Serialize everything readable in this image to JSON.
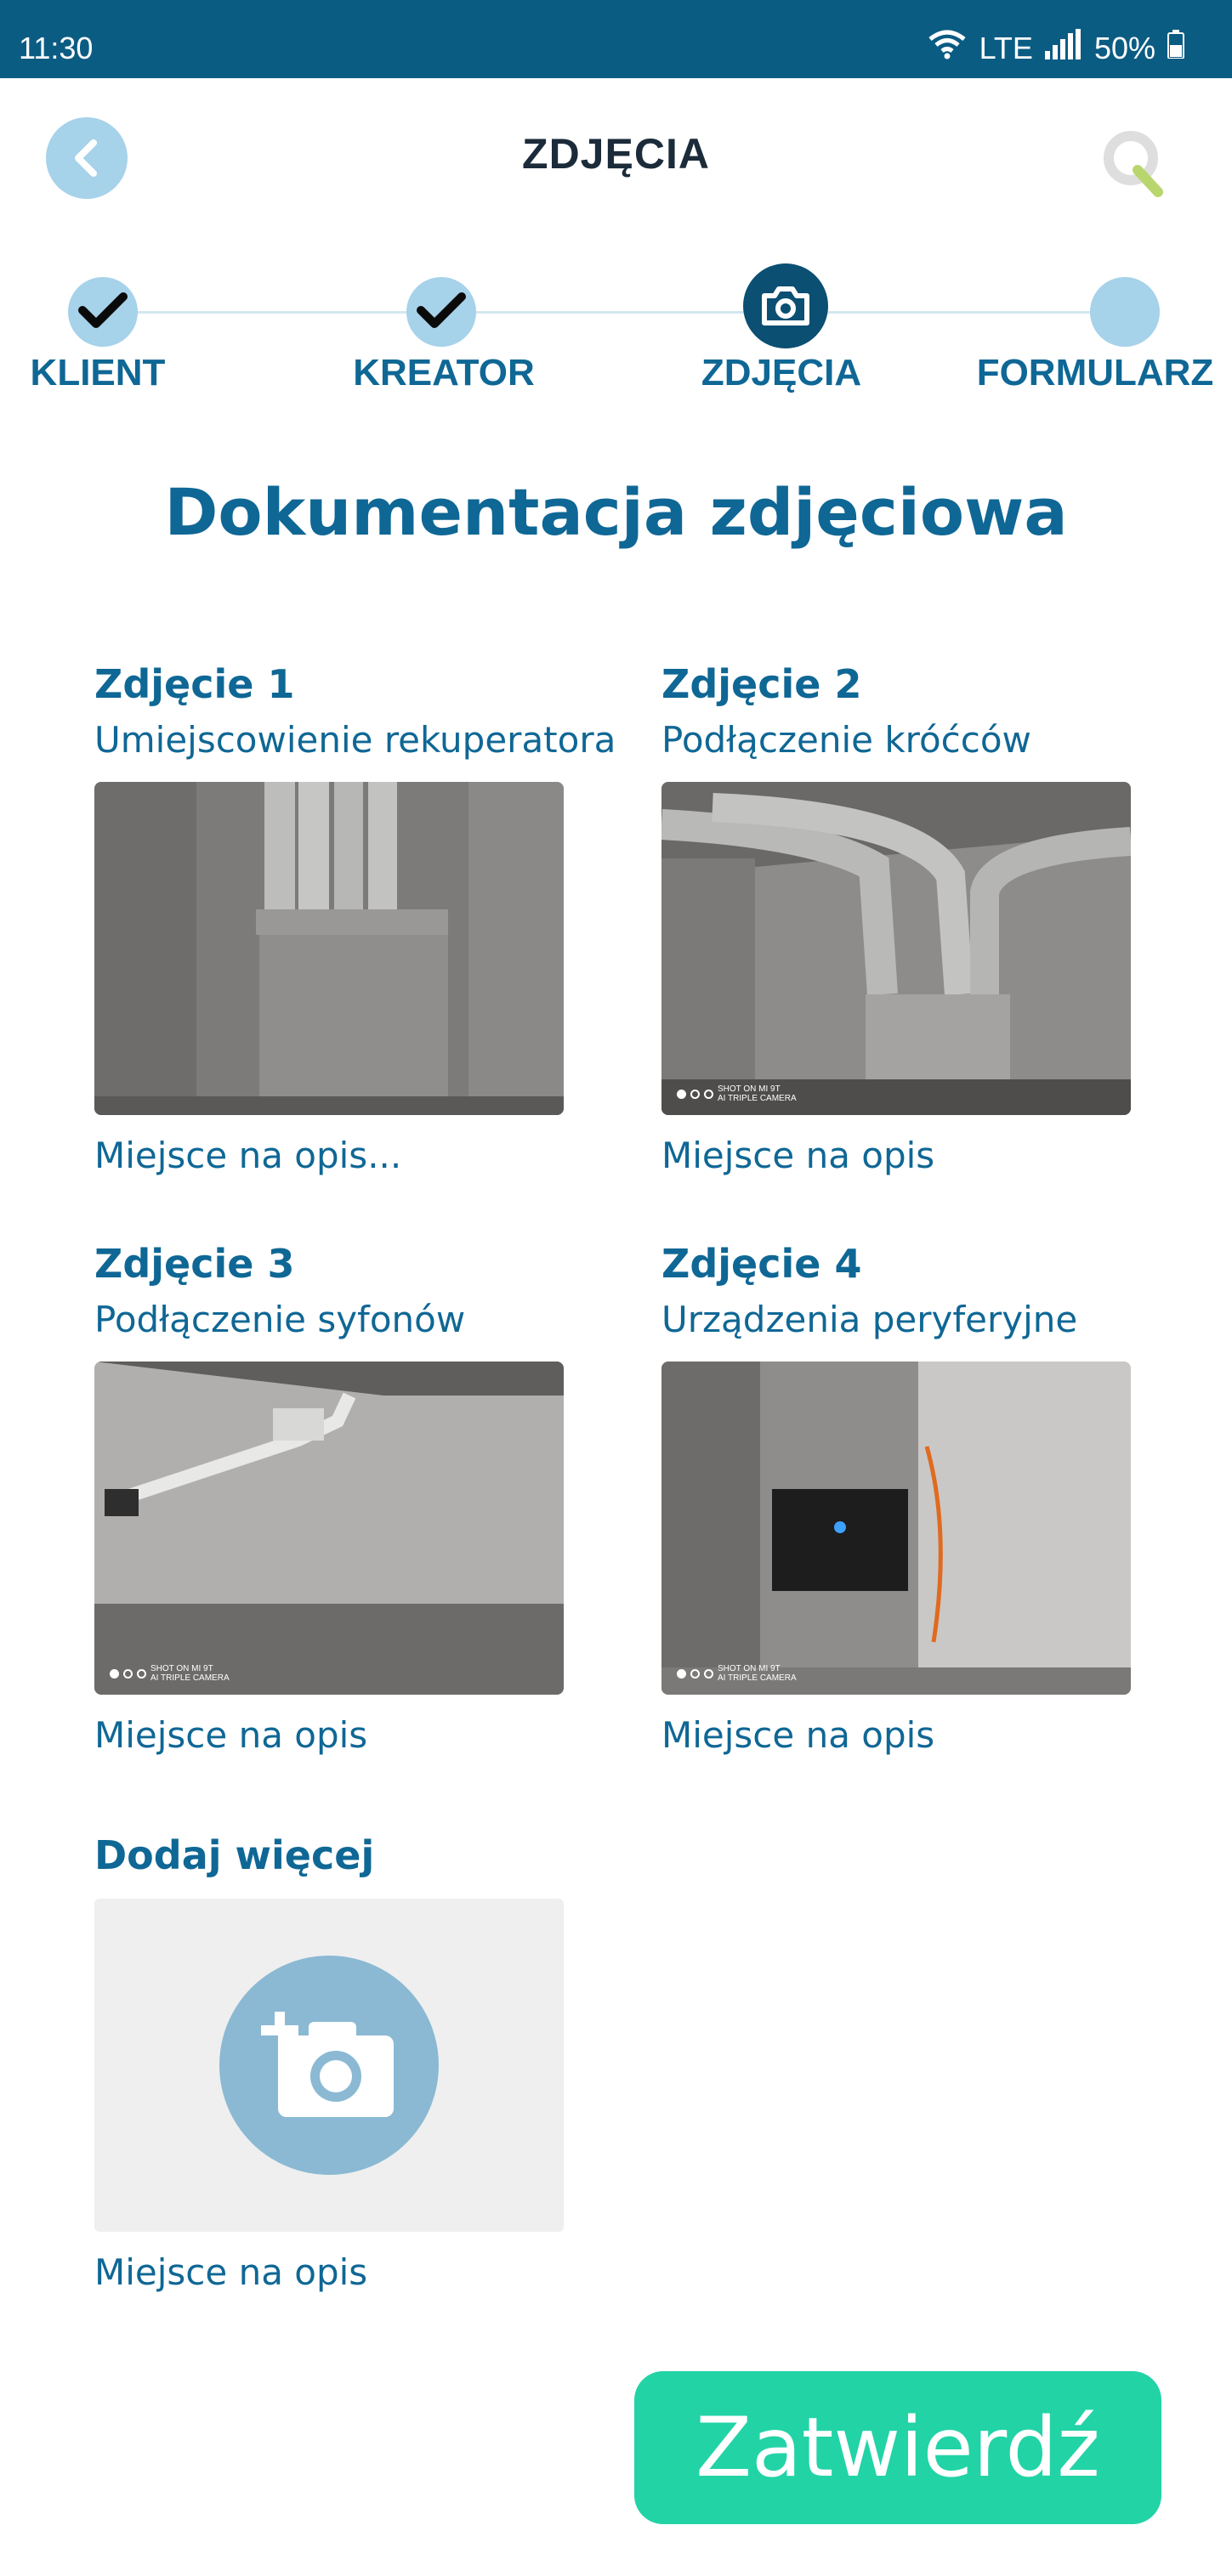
{
  "status_bar": {
    "time": "11:30",
    "network": "LTE",
    "battery": "50%",
    "icons": [
      "wifi-icon",
      "signal-icon",
      "battery-icon"
    ]
  },
  "header": {
    "title": "ZDJĘCIA",
    "back_icon": "chevron-left-icon",
    "logo_icon": "q-logo-icon"
  },
  "stepper": {
    "steps": [
      {
        "label": "KLIENT",
        "state": "done",
        "icon": "check-icon"
      },
      {
        "label": "KREATOR",
        "state": "done",
        "icon": "check-icon"
      },
      {
        "label": "ZDJĘCIA",
        "state": "active",
        "icon": "camera-icon"
      },
      {
        "label": "FORMULARZ",
        "state": "pending",
        "icon": ""
      }
    ]
  },
  "page": {
    "heading": "Dokumentacja zdjęciowa"
  },
  "photos": [
    {
      "title": "Zdjęcie 1",
      "subtitle": "Umiejscowienie rekuperatora",
      "description": "Miejsce na opis...",
      "watermark": ""
    },
    {
      "title": "Zdjęcie 2",
      "subtitle": "Podłączenie króćców",
      "description": "Miejsce na opis",
      "watermark": "SHOT ON MI 9T"
    },
    {
      "title": "Zdjęcie 3",
      "subtitle": "Podłączenie syfonów",
      "description": "Miejsce na opis",
      "watermark": "SHOT ON MI 9T"
    },
    {
      "title": "Zdjęcie 4",
      "subtitle": "Urządzenia peryferyjne",
      "description": "Miejsce na opis",
      "watermark": "SHOT ON MI 9T"
    }
  ],
  "watermark_sub": "AI TRIPLE CAMERA",
  "add_more": {
    "title": "Dodaj więcej",
    "description": "Miejsce na opis",
    "icon": "add-photo-icon"
  },
  "confirm_button": {
    "label": "Zatwierdź"
  },
  "colors": {
    "primary": "#0f6795",
    "status_bar": "#0b5c83",
    "light_blue": "#a6d2ea",
    "accent_green": "#22d3a6",
    "add_circle": "#8bb9d3"
  }
}
